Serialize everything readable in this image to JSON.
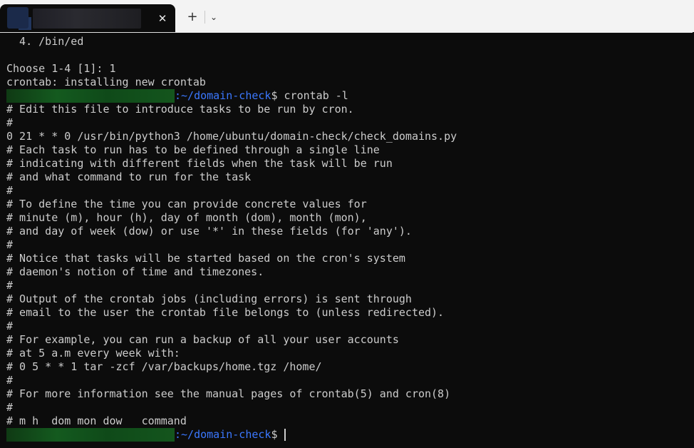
{
  "tabbar": {
    "close_glyph": "✕",
    "new_tab_glyph": "+",
    "dropdown_glyph": "⌄"
  },
  "terminal": {
    "lines": [
      {
        "type": "text",
        "text": "  4. /bin/ed"
      },
      {
        "type": "text",
        "text": ""
      },
      {
        "type": "text",
        "text": "Choose 1-4 [1]: 1"
      },
      {
        "type": "text",
        "text": "crontab: installing new crontab"
      },
      {
        "type": "prompt",
        "path": ":~/domain-check",
        "suffix": "$ crontab -l"
      },
      {
        "type": "text",
        "text": "# Edit this file to introduce tasks to be run by cron."
      },
      {
        "type": "text",
        "text": "#"
      },
      {
        "type": "text",
        "text": "0 21 * * 0 /usr/bin/python3 /home/ubuntu/domain-check/check_domains.py"
      },
      {
        "type": "text",
        "text": "# Each task to run has to be defined through a single line"
      },
      {
        "type": "text",
        "text": "# indicating with different fields when the task will be run"
      },
      {
        "type": "text",
        "text": "# and what command to run for the task"
      },
      {
        "type": "text",
        "text": "#"
      },
      {
        "type": "text",
        "text": "# To define the time you can provide concrete values for"
      },
      {
        "type": "text",
        "text": "# minute (m), hour (h), day of month (dom), month (mon),"
      },
      {
        "type": "text",
        "text": "# and day of week (dow) or use '*' in these fields (for 'any')."
      },
      {
        "type": "text",
        "text": "#"
      },
      {
        "type": "text",
        "text": "# Notice that tasks will be started based on the cron's system"
      },
      {
        "type": "text",
        "text": "# daemon's notion of time and timezones."
      },
      {
        "type": "text",
        "text": "#"
      },
      {
        "type": "text",
        "text": "# Output of the crontab jobs (including errors) is sent through"
      },
      {
        "type": "text",
        "text": "# email to the user the crontab file belongs to (unless redirected)."
      },
      {
        "type": "text",
        "text": "#"
      },
      {
        "type": "text",
        "text": "# For example, you can run a backup of all your user accounts"
      },
      {
        "type": "text",
        "text": "# at 5 a.m every week with:"
      },
      {
        "type": "text",
        "text": "# 0 5 * * 1 tar -zcf /var/backups/home.tgz /home/"
      },
      {
        "type": "text",
        "text": "#"
      },
      {
        "type": "text",
        "text": "# For more information see the manual pages of crontab(5) and cron(8)"
      },
      {
        "type": "text",
        "text": "#"
      },
      {
        "type": "text",
        "text": "# m h  dom mon dow   command"
      },
      {
        "type": "prompt",
        "path": ":~/domain-check",
        "suffix": "$ ",
        "cursor": true
      }
    ]
  },
  "colors": {
    "background": "#0c0c0c",
    "foreground": "#cccccc",
    "path": "#3b78ff",
    "user_host": "#145a1f",
    "tabbar": "#f3f3f3"
  }
}
